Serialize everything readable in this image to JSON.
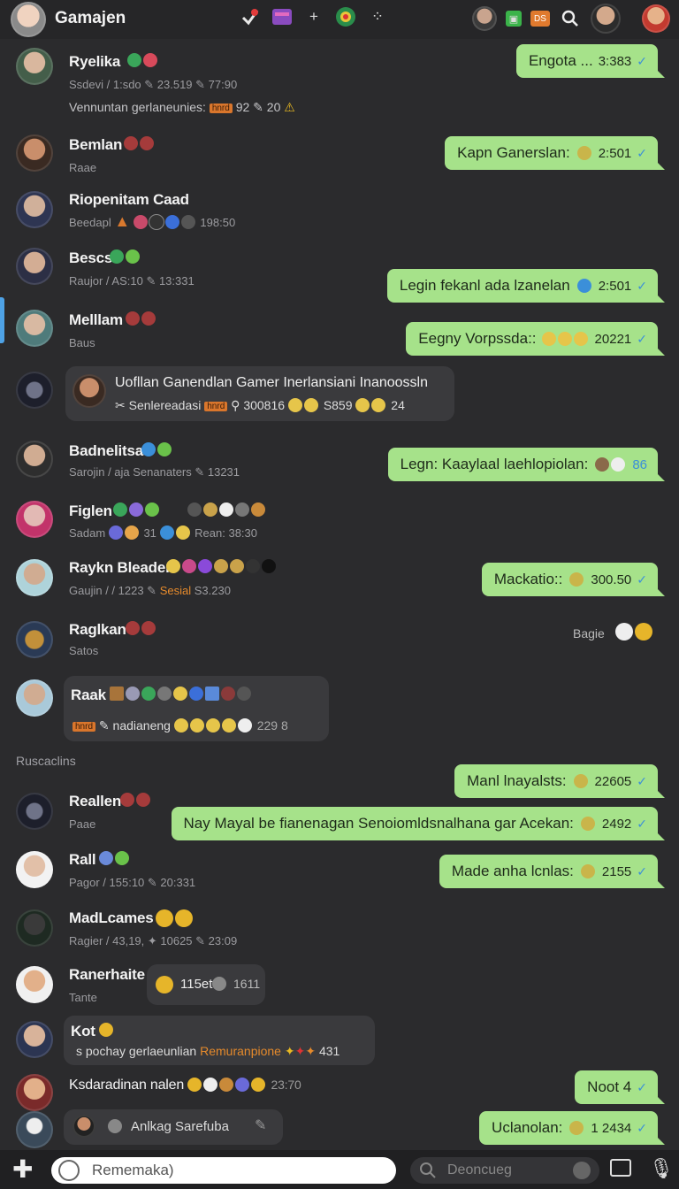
{
  "header": {
    "title": "Gamajen"
  },
  "footer": {
    "message_placeholder": "Rememaka)",
    "search_placeholder": "Deoncueg"
  },
  "sections": {
    "separator": "Ruscaclins"
  },
  "chats": [
    {
      "name": "Ryelika",
      "sub": "Ssdevi  /  1:sdo  ✎ 23.519  ✎ 77:90",
      "sub2": "Vennuntan gerlaneunies:",
      "sub2_tag": "hnrd",
      "sub2_tail": "92  ✎ 20",
      "out": "Engota ...",
      "out_time": "3:383"
    },
    {
      "name": "Bemlan",
      "sub": "Raae",
      "out": "Kapn Ganerslan:",
      "out_time": "2:501"
    },
    {
      "name": "Riopenitam Caad",
      "sub": "Beedapl",
      "sub_tail": "198:50"
    },
    {
      "name": "Bescs",
      "sub": "Raujor  /  AS:10  ✎ 13:331",
      "out": "Legin fekanl ada lzanelan",
      "out_time": "2:501"
    },
    {
      "name": "Melllam",
      "sub": "Baus",
      "out": "Eegny Vorpssda::",
      "out_time": "20221"
    },
    {
      "name": "Uofllan Ganendlan Gamer Inerlansiani Inanoossln",
      "sub": "Senlereadasi",
      "sub_tag": "hnrd",
      "sub_tail": "300816",
      "sub_tail2": "S859",
      "sub_tail3": "24"
    },
    {
      "name": "Badnelitsa",
      "sub": "Sarojin  /  aja Senanaters  ✎ 13231",
      "out": "Legn: Kaaylaal laehlopiolan:",
      "out_time": "86"
    },
    {
      "name": "Figlen",
      "sub": "Sadam",
      "sub_tail": "31",
      "sub_tail2": "Rean: 38:30"
    },
    {
      "name": "Raykn Bleader",
      "sub": "Gaujin  /  /  1223  ✎",
      "sub_orange": "Sesial",
      "sub_tail": "S3.230",
      "out": "Mackatio::",
      "out_time": "300.50"
    },
    {
      "name": "Raglkan",
      "sub": "Satos",
      "right_label": "Bagie"
    },
    {
      "name": "Raak",
      "sub": "nadianeng",
      "sub_tag": "hnrd",
      "sub_tail": "229 8"
    },
    {
      "name": "Reallen",
      "sub": "Paae",
      "out": "Manl lnayalsts:",
      "out_time": "22605"
    },
    {
      "name": "Rall",
      "sub": "Pagor  /  155:10  ✎ 20:331",
      "out": "Nay Mayal be fianenagan Senoiomldsnalhana gar Acekan:",
      "out_time": "2492"
    },
    {
      "name": "MadLcames",
      "sub": "Ragier  /  43,19,  ✦ 10625  ✎ 23:09",
      "out": "Made anha lcnlas:",
      "out_time": "2155"
    },
    {
      "name": "Ranerhaite",
      "sub": "Tante",
      "bubble": "115et",
      "bubble_tail": "1611"
    },
    {
      "name": "Kot",
      "sub": "s pochay gerlaeunlian",
      "sub_orange": "Remuranpione",
      "sub_tail": "431"
    },
    {
      "name": "Ksdaradinan nalen",
      "sub_tail": "23:70",
      "out": "Noot 4"
    },
    {
      "name": "Anlkag Sarefuba",
      "out": "Uclanolan:",
      "out_time": "1 2434"
    }
  ],
  "colors": {
    "background": "#2b2b2d",
    "out_bubble": "#a6e28a",
    "in_bubble": "#3a3a3d",
    "accent": "#4ea2e6"
  },
  "icons": [
    "messenger-icon",
    "game-icon",
    "plus-icon",
    "ball-icon",
    "dots-icon",
    "search-icon",
    "mic-icon",
    "attach-icon",
    "emoji-icon",
    "screen-icon",
    "plus-add-icon"
  ]
}
